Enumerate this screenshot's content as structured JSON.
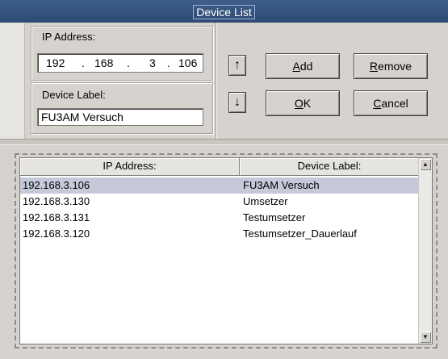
{
  "window": {
    "title": "Device List"
  },
  "ip_group": {
    "label": "IP Address:",
    "octets": [
      "192",
      "168",
      "3",
      "106"
    ],
    "separator": "."
  },
  "label_group": {
    "label": "Device Label:",
    "value": "FU3AM Versuch"
  },
  "buttons": {
    "up_icon": "up-arrow-icon",
    "down_icon": "down-arrow-icon",
    "up_glyph": "↑",
    "down_glyph": "↓",
    "add": {
      "hotkey": "A",
      "rest": "dd"
    },
    "ok": {
      "hotkey": "O",
      "rest": "K"
    },
    "remove": {
      "hotkey": "R",
      "rest": "emove"
    },
    "cancel": {
      "hotkey": "C",
      "rest": "ancel"
    }
  },
  "list": {
    "columns": [
      "IP Address:",
      "Device Label:"
    ],
    "rows": [
      {
        "ip": "192.168.3.106",
        "label": "FU3AM Versuch",
        "selected": true
      },
      {
        "ip": "192.168.3.130",
        "label": "Umsetzer",
        "selected": false
      },
      {
        "ip": "192.168.3.131",
        "label": "Testumsetzer",
        "selected": false
      },
      {
        "ip": "192.168.3.120",
        "label": "Testumsetzer_Dauerlauf",
        "selected": false
      }
    ],
    "scroll_up_glyph": "▲",
    "scroll_down_glyph": "▼"
  }
}
